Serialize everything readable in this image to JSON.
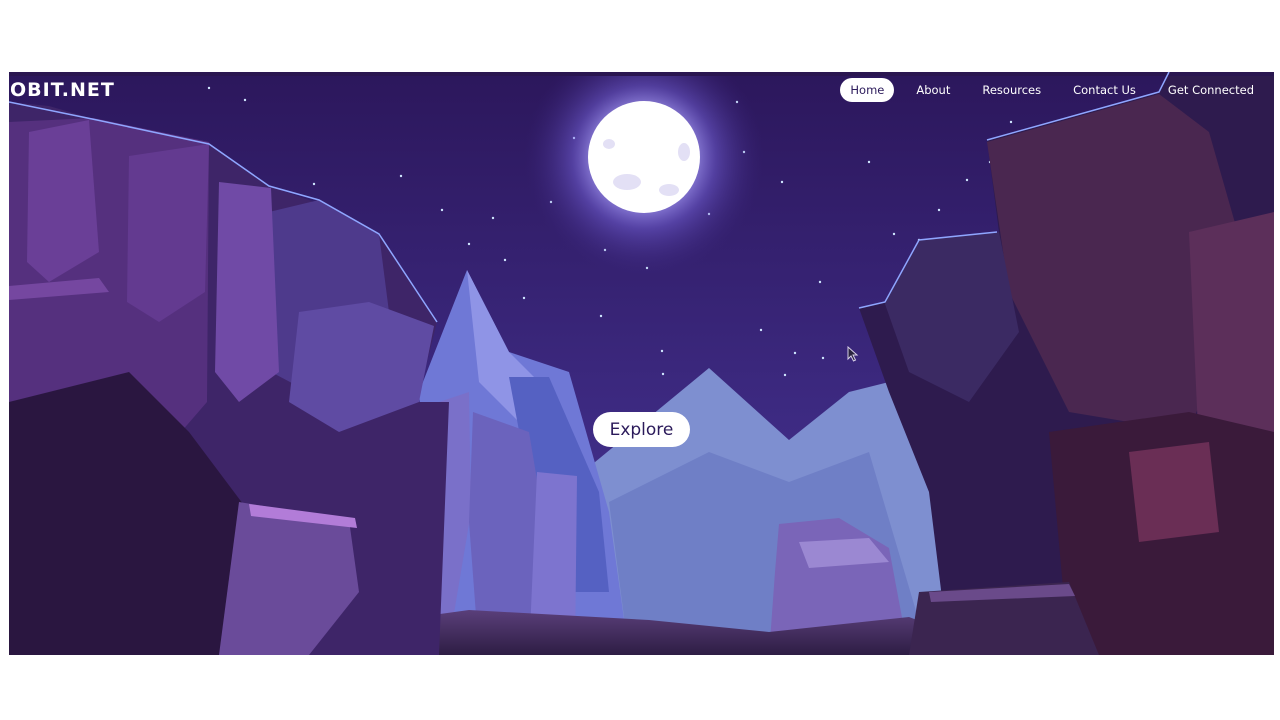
{
  "brand": {
    "name": "OBIT.NET"
  },
  "nav": {
    "items": [
      {
        "label": "Home",
        "active": true
      },
      {
        "label": "About",
        "active": false
      },
      {
        "label": "Resources",
        "active": false
      },
      {
        "label": "Contact Us",
        "active": false
      },
      {
        "label": "Get Connected",
        "active": false
      }
    ]
  },
  "hero": {
    "cta_label": "Explore",
    "illustration": "night-canyon-moon",
    "colors": {
      "sky": "#2f1b63",
      "moon": "#ffffff",
      "accent": "#6f63c9"
    }
  }
}
